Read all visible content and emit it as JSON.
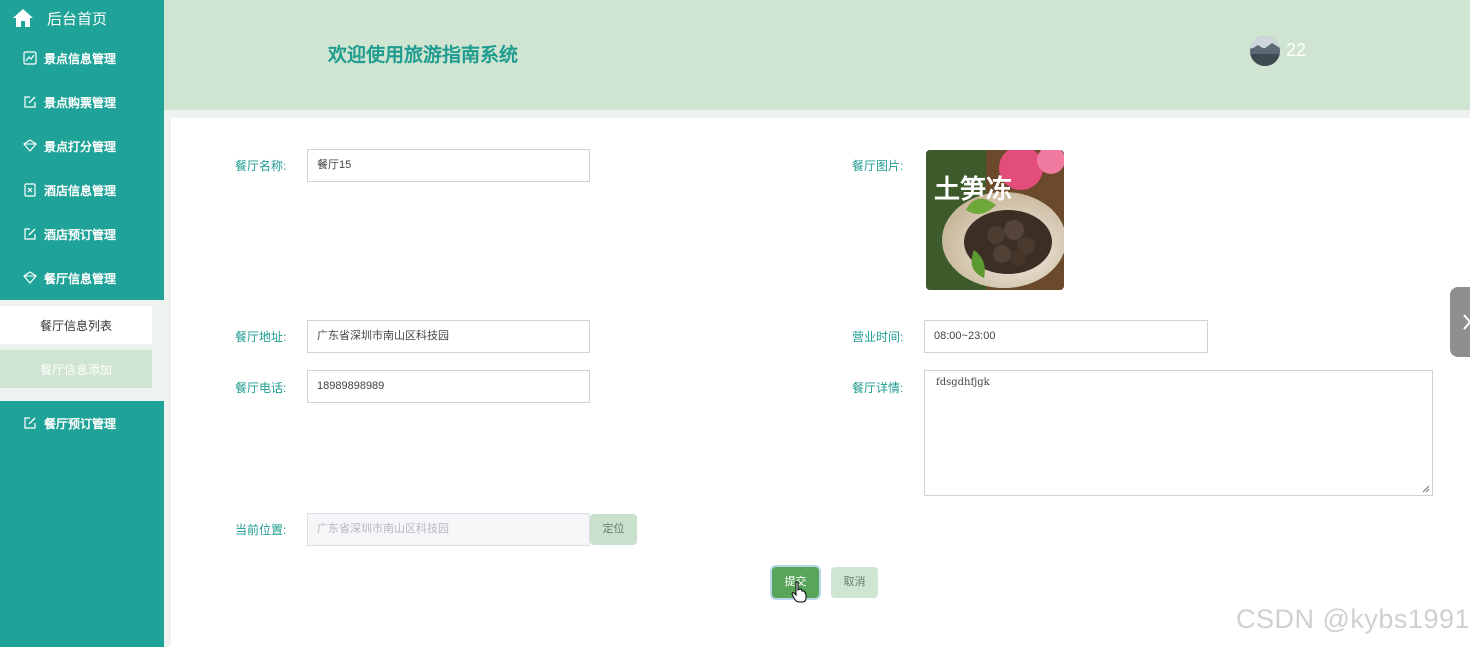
{
  "sidebar": {
    "home_label": "后台首页",
    "items": [
      {
        "label": "景点信息管理",
        "icon": "chart-icon"
      },
      {
        "label": "景点购票管理",
        "icon": "edit-icon"
      },
      {
        "label": "景点打分管理",
        "icon": "diamond-icon"
      },
      {
        "label": "酒店信息管理",
        "icon": "close-box-icon"
      },
      {
        "label": "酒店预订管理",
        "icon": "edit-icon"
      },
      {
        "label": "餐厅信息管理",
        "icon": "diamond-icon"
      },
      {
        "label": "餐厅预订管理",
        "icon": "edit-icon"
      }
    ],
    "sub_items": [
      {
        "label": "餐厅信息列表"
      },
      {
        "label": "餐厅信息添加"
      }
    ]
  },
  "header": {
    "title": "欢迎使用旅游指南系统",
    "username": "22"
  },
  "form": {
    "name_label": "餐厅名称:",
    "name_value": "餐厅15",
    "image_label": "餐厅图片:",
    "address_label": "餐厅地址:",
    "address_value": "广东省深圳市南山区科技园",
    "hours_label": "营业时间:",
    "hours_value": "08:00~23:00",
    "phone_label": "餐厅电话:",
    "phone_value": "18989898989",
    "detail_label": "餐厅详情:",
    "detail_value": "fdsgdhfjgk",
    "location_label": "当前位置:",
    "location_value": "广东省深圳市南山区科技园",
    "locate_button": "定位",
    "submit_button": "提交",
    "cancel_button": "取消",
    "image_text": "土笋冻"
  },
  "watermark": "CSDN @kybs1991",
  "colors": {
    "sidebar_bg": "#1fa297",
    "header_bg": "#cfe4d1",
    "accent": "#1f9c90",
    "submit_bg": "#5aa55c"
  }
}
